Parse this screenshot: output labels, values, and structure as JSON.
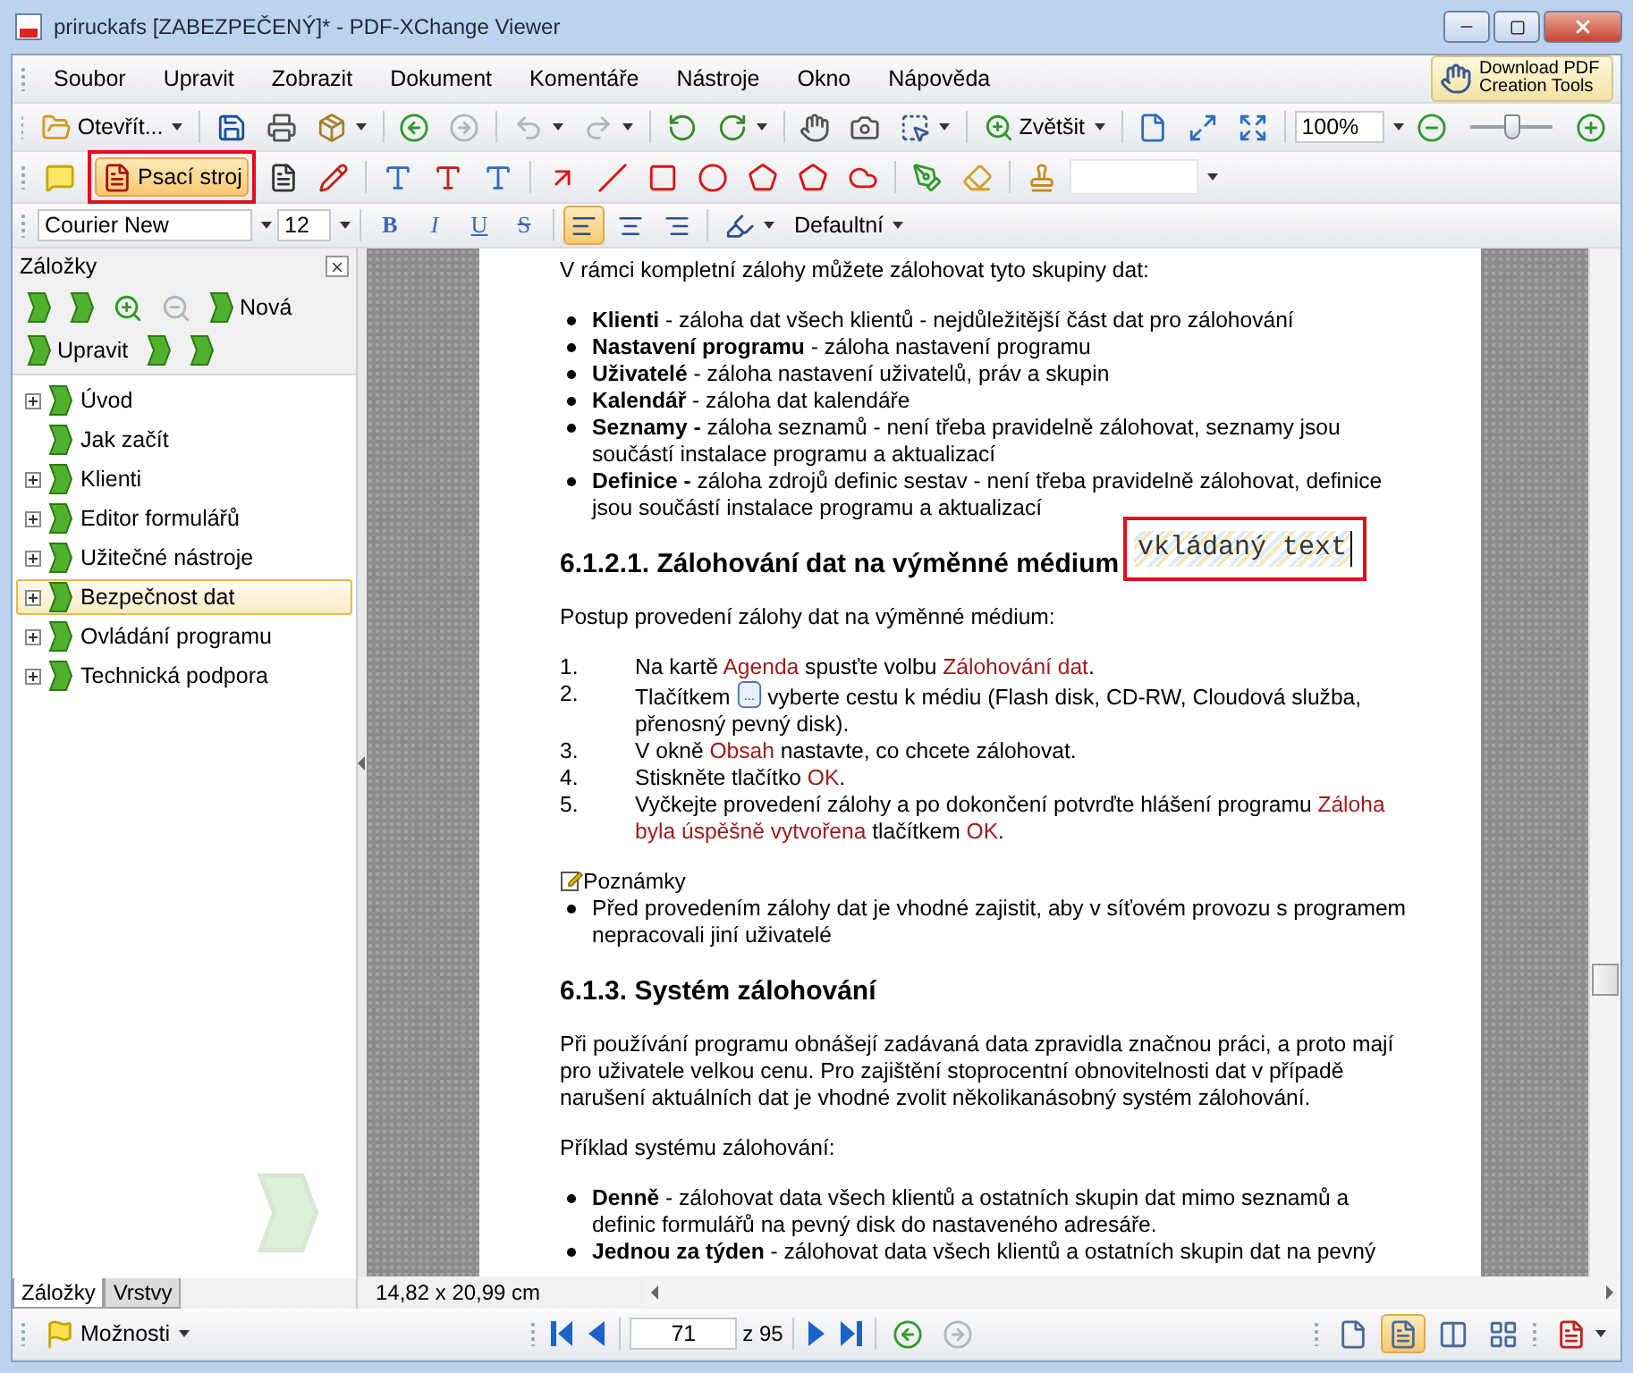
{
  "window": {
    "title": "priruckafs [ZABEZPEČENÝ]* - PDF-XChange Viewer"
  },
  "menu": {
    "items": [
      "Soubor",
      "Upravit",
      "Zobrazit",
      "Dokument",
      "Komentáře",
      "Nástroje",
      "Okno",
      "Nápověda"
    ],
    "promo": "Download PDF Creation Tools"
  },
  "toolbar": {
    "open": "Otevřít...",
    "back": {
      "disabled": false
    },
    "forward": {
      "disabled": true
    },
    "undo": {
      "disabled": true
    },
    "redo": {
      "disabled": true
    },
    "zoom_tool": "Zvětšit",
    "zoom_value": "100%",
    "zoom_slider": {
      "level": 0.5
    }
  },
  "tools": {
    "typewriter": {
      "label": "Psací stroj",
      "selected": true,
      "highlighted": true
    }
  },
  "format": {
    "font": "Courier New",
    "size": "12",
    "styles": [
      {
        "label": "B",
        "kind": "bold"
      },
      {
        "label": "I",
        "kind": "italic"
      },
      {
        "label": "U",
        "kind": "underline"
      },
      {
        "label": "S",
        "kind": "strike"
      }
    ],
    "alignments": [
      {
        "kind": "left",
        "selected": true
      },
      {
        "kind": "center",
        "selected": false
      },
      {
        "kind": "right",
        "selected": false
      }
    ],
    "style": "Defaultní"
  },
  "sidebar": {
    "title": "Záložky",
    "new": "Nová",
    "edit": "Upravit",
    "tree": [
      {
        "label": "Úvod",
        "expandable": true,
        "selected": false
      },
      {
        "label": "Jak začít",
        "expandable": false,
        "selected": false
      },
      {
        "label": "Klienti",
        "expandable": true,
        "selected": false
      },
      {
        "label": "Editor formulářů",
        "expandable": true,
        "selected": false
      },
      {
        "label": "Užitečné nástroje",
        "expandable": true,
        "selected": false
      },
      {
        "label": "Bezpečnost dat",
        "expandable": true,
        "selected": true
      },
      {
        "label": "Ovládání programu",
        "expandable": true,
        "selected": false
      },
      {
        "label": "Technická podpora",
        "expandable": true,
        "selected": false
      }
    ],
    "tabs": [
      {
        "label": "Záložky",
        "selected": true
      },
      {
        "label": "Vrstvy",
        "selected": false
      }
    ]
  },
  "document": {
    "blocks": [
      {
        "kind": "paragraph",
        "text": "V rámci kompletní zálohy můžete zálohovat tyto skupiny dat:"
      },
      {
        "kind": "bullet",
        "text": "**Klienti** - záloha dat všech klientů - nejdůležitější část dat pro zálohování"
      },
      {
        "kind": "bullet",
        "text": "**Nastavení programu** - záloha nastavení programu"
      },
      {
        "kind": "bullet",
        "text": "**Uživatelé** - záloha nastavení uživatelů, práv a skupin"
      },
      {
        "kind": "bullet",
        "text": "**Kalendář** - záloha dat kalendáře"
      },
      {
        "kind": "bullet",
        "text": "**Seznamy -** záloha seznamů - není třeba pravidelně zálohovat, seznamy jsou součástí instalace programu a aktualizací"
      },
      {
        "kind": "bullet",
        "text": "**Definice -** záloha zdrojů definic sestav - není třeba pravidelně zálohovat, definice jsou součástí instalace programu a aktualizací"
      },
      {
        "kind": "heading",
        "text": "6.1.2.1. Zálohování dat na výměnné médium"
      },
      {
        "kind": "paragraph",
        "text": "Postup provedení zálohy dat na výměnné médium:"
      },
      {
        "kind": "step",
        "number": "1.",
        "parts": [
          {
            "kind": "plain",
            "text": "Na kartě "
          },
          {
            "kind": "ref",
            "text": "Agenda"
          },
          {
            "kind": "plain",
            "text": " spusťte volbu "
          },
          {
            "kind": "ref",
            "text": "Zálohování dat"
          },
          {
            "kind": "plain",
            "text": "."
          }
        ]
      },
      {
        "kind": "step",
        "number": "2.",
        "parts": [
          {
            "kind": "plain",
            "text": "Tlačítkem "
          },
          {
            "kind": "button",
            "text": "..."
          },
          {
            "kind": "plain",
            "text": " vyberte cestu k médiu (Flash disk, CD-RW, Cloudová služba, přenosný pevný disk)."
          }
        ]
      },
      {
        "kind": "step",
        "number": "3.",
        "parts": [
          {
            "kind": "plain",
            "text": "V okně "
          },
          {
            "kind": "ref",
            "text": "Obsah"
          },
          {
            "kind": "plain",
            "text": " nastavte, co chcete zálohovat."
          }
        ]
      },
      {
        "kind": "step",
        "number": "4.",
        "parts": [
          {
            "kind": "plain",
            "text": "Stiskněte tlačítko "
          },
          {
            "kind": "ref",
            "text": "OK"
          },
          {
            "kind": "plain",
            "text": "."
          }
        ]
      },
      {
        "kind": "step",
        "number": "5.",
        "parts": [
          {
            "kind": "plain",
            "text": "Vyčkejte provedení zálohy a po dokončení potvrďte hlášení programu "
          },
          {
            "kind": "ref",
            "text": "Záloha byla úspěšně vytvořena"
          },
          {
            "kind": "plain",
            "text": " tlačítkem "
          },
          {
            "kind": "ref",
            "text": "OK"
          },
          {
            "kind": "plain",
            "text": "."
          }
        ]
      },
      {
        "kind": "note",
        "text": "Poznámky"
      },
      {
        "kind": "bullet",
        "text": "Před provedením zálohy dat je vhodné zajistit, aby v síťovém provozu s programem nepracovali jiní uživatelé"
      },
      {
        "kind": "heading",
        "text": "6.1.3. Systém zálohování"
      },
      {
        "kind": "paragraph",
        "text": "Při používání programu obnášejí zadávaná data zpravidla značnou práci, a proto mají pro uživatele velkou cenu. Pro zajištění stoprocentní obnovitelnosti dat v případě narušení aktuálních dat je vhodné zvolit několikanásobný systém zálohování."
      },
      {
        "kind": "paragraph",
        "text": "Příklad systému zálohování:"
      },
      {
        "kind": "bullet",
        "text": "**Denně** - zálohovat data všech klientů a ostatních skupin dat mimo seznamů a definic formulářů na pevný disk do nastaveného adresáře."
      },
      {
        "kind": "bullet",
        "text": "**Jednou za týden** - zálohovat data všech klientů a ostatních skupin dat na pevný"
      }
    ],
    "typed_text": {
      "value": "vkládaný text",
      "highlighted": true
    },
    "page_size": "14,82 x 20,99 cm"
  },
  "navigation": {
    "options": "Možnosti",
    "back": {
      "disabled": false
    },
    "forward": {
      "disabled": true
    },
    "page": "71",
    "total": "z 95",
    "view_modes": [
      {
        "kind": "single",
        "selected": false
      },
      {
        "kind": "continuous",
        "selected": true
      },
      {
        "kind": "facing",
        "selected": false
      },
      {
        "kind": "facing_continuous",
        "selected": false
      }
    ]
  }
}
